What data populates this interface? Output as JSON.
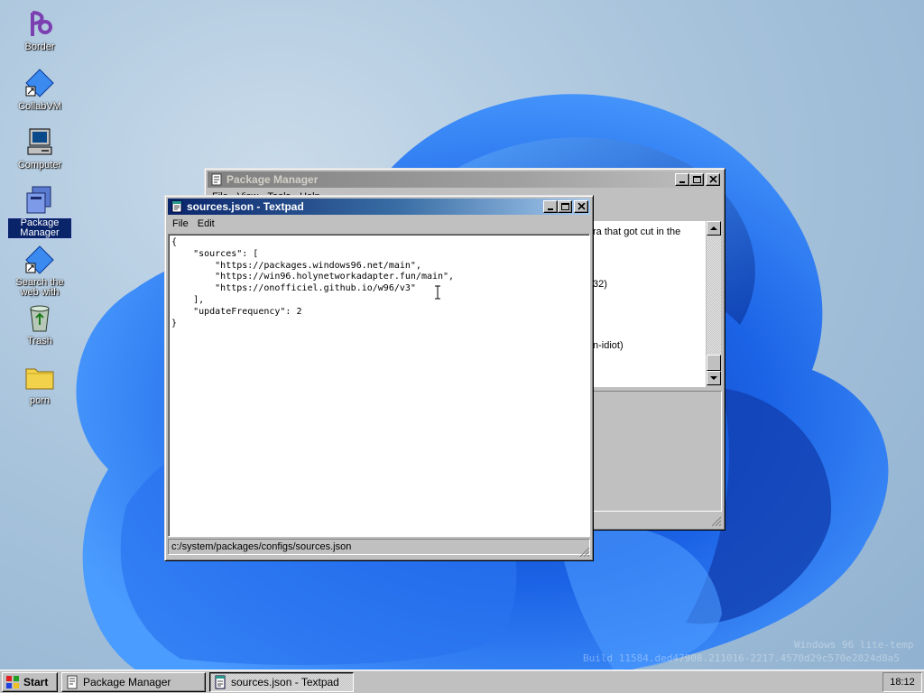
{
  "desktop": {
    "icons": [
      {
        "label": "Border",
        "icon": "border-app-icon"
      },
      {
        "label": "CollabVM",
        "icon": "collabvm-shortcut-icon"
      },
      {
        "label": "Computer",
        "icon": "computer-icon"
      },
      {
        "label": "Package Manager",
        "icon": "package-manager-icon"
      },
      {
        "label": "Search the web with Bing",
        "icon": "bing-shortcut-icon"
      },
      {
        "label": "Trash",
        "icon": "trash-icon"
      },
      {
        "label": "porn",
        "icon": "folder-icon"
      }
    ]
  },
  "package_manager": {
    "title": "Package Manager",
    "menu": [
      "File",
      "View",
      "Tools",
      "Help"
    ],
    "visible_text_fragments": [
      "ra that got cut in the",
      "32)",
      "n-idiot)"
    ]
  },
  "textpad": {
    "title": "sources.json - Textpad",
    "menu": [
      "File",
      "Edit"
    ],
    "content": "{\n    \"sources\": [\n        \"https://packages.windows96.net/main\",\n        \"https://win96.holynetworkadapter.fun/main\",\n        \"https://onofficiel.github.io/w96/v3\"\n    ],\n    \"updateFrequency\": 2\n}",
    "status_path": "c:/system/packages/configs/sources.json"
  },
  "taskbar": {
    "start_label": "Start",
    "tasks": [
      {
        "label": "Package Manager",
        "active": false
      },
      {
        "label": "sources.json - Textpad",
        "active": true
      }
    ],
    "clock": "18:12"
  },
  "watermark": {
    "line1": "Windows 96 lite-temp",
    "line2": "Build 11584.ded47908.211016-2217.4570d29c570e2824d8a5"
  },
  "colors": {
    "active_title": "#0a246a",
    "inactive_title": "#808080",
    "wallpaper_bloom": "#1a5fe0"
  }
}
